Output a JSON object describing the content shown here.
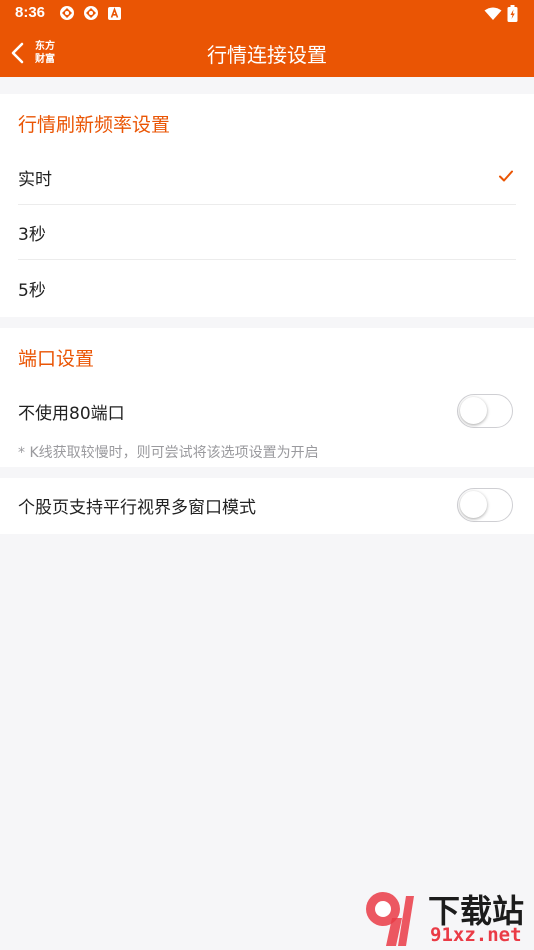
{
  "colors": {
    "accent": "#ea5504",
    "background": "#f6f6f8",
    "divider": "#ececec",
    "note_text": "#9a9a9e",
    "watermark_red": "#ea3b46"
  },
  "status_bar": {
    "time": "8:36",
    "icons": [
      "app-notification-icon",
      "app-notification-icon",
      "a-letter-icon",
      "wifi-icon",
      "battery-icon"
    ]
  },
  "header": {
    "back_icon": "chevron-left-icon",
    "logo_text": "东方财富",
    "title": "行情连接设置"
  },
  "refresh_section": {
    "title": "行情刷新频率设置",
    "options": [
      {
        "label": "实时",
        "selected": true
      },
      {
        "label": "3秒",
        "selected": false
      },
      {
        "label": "5秒",
        "selected": false
      }
    ]
  },
  "port_section": {
    "title": "端口设置",
    "toggle_label": "不使用80端口",
    "toggle_on": false,
    "note": "* K线获取较慢时，则可尝试将该选项设置为开启"
  },
  "multiwindow": {
    "label": "个股页支持平行视界多窗口模式",
    "toggle_on": false
  },
  "watermark": {
    "cn": "下载站",
    "en": "91xz.net"
  }
}
